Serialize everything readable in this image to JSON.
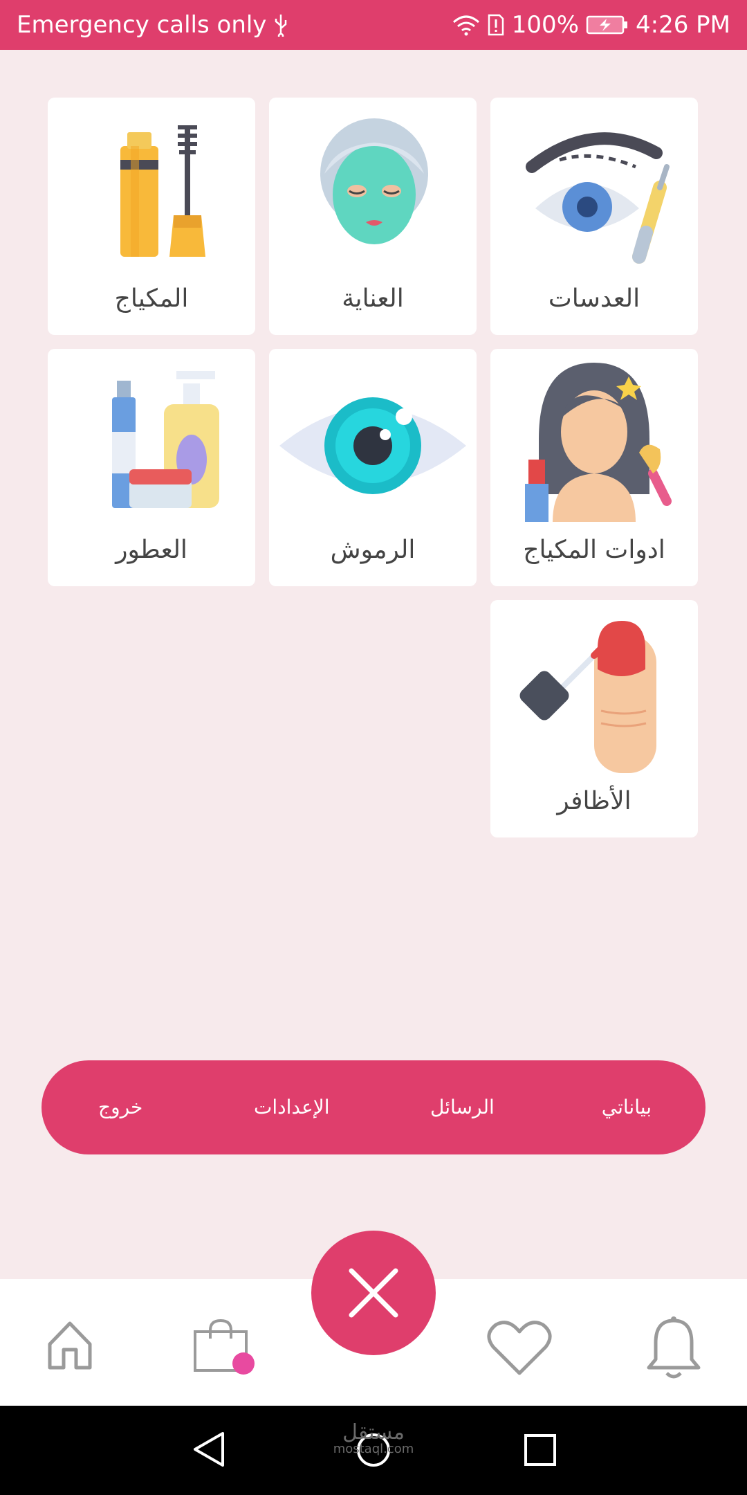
{
  "status_bar": {
    "carrier_text": "Emergency calls only",
    "battery": "100%",
    "time": "4:26 PM",
    "icons": [
      "usb-icon",
      "wifi-icon",
      "sim-alert-icon",
      "battery-icon"
    ]
  },
  "categories": [
    {
      "label": "المكياج",
      "icon": "makeup-icon"
    },
    {
      "label": "العناية",
      "icon": "face-mask-icon"
    },
    {
      "label": "العدسات",
      "icon": "eye-lens-icon"
    },
    {
      "label": "العطور",
      "icon": "perfume-icon"
    },
    {
      "label": "الرموش",
      "icon": "eye-icon"
    },
    {
      "label": "ادوات المكياج",
      "icon": "makeup-tools-icon"
    },
    {
      "label": "الأظافر",
      "icon": "nail-polish-icon"
    }
  ],
  "menu": {
    "items": [
      {
        "label": "بياناتي"
      },
      {
        "label": "الرسائل"
      },
      {
        "label": "الإعدادات"
      },
      {
        "label": "خروج"
      }
    ]
  },
  "bottom_nav": {
    "icons": [
      "home-icon",
      "shopping-bag-icon",
      "close-icon",
      "heart-icon",
      "bell-icon"
    ]
  },
  "watermark": {
    "main": "مستقل",
    "sub": "mostaql.com"
  },
  "colors": {
    "accent": "#df3e6c",
    "background": "#f7eaec",
    "badge": "#e84aa0"
  }
}
